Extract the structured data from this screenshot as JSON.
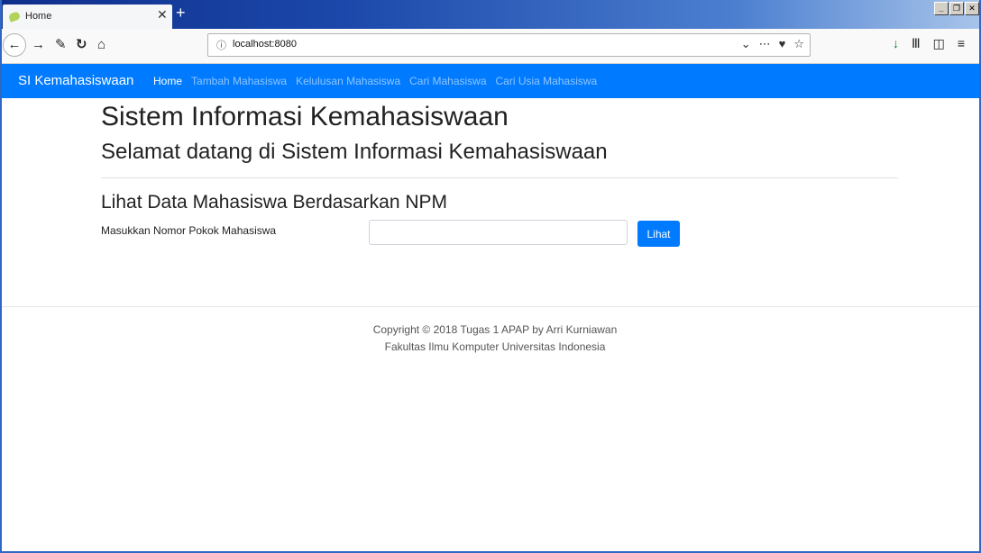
{
  "browser": {
    "tab_title": "Home",
    "url": "localhost:8080",
    "colors": {
      "tab_strip": "#1b48aa",
      "nav_bar": "#f9f9fa"
    }
  },
  "navbar": {
    "brand": "SI Kemahasiswaan",
    "links": [
      {
        "label": "Home",
        "active": true
      },
      {
        "label": "Tambah Mahasiswa",
        "active": false
      },
      {
        "label": "Kelulusan Mahasiswa",
        "active": false
      },
      {
        "label": "Cari Mahasiswa",
        "active": false
      },
      {
        "label": "Cari Usia Mahasiswa",
        "active": false
      }
    ],
    "color": "#007bff"
  },
  "main": {
    "title": "Sistem Informasi Kemahasiswaan",
    "subtitle": "Selamat datang di Sistem Informasi Kemahasiswaan",
    "section_title": "Lihat Data Mahasiswa Berdasarkan NPM",
    "npm_label": "Masukkan Nomor Pokok Mahasiswa",
    "npm_value": "",
    "submit_label": "Lihat"
  },
  "footer": {
    "line1": "Copyright © 2018 Tugas 1 APAP by Arri Kurniawan",
    "line2": "Fakultas Ilmu Komputer Universitas Indonesia"
  }
}
